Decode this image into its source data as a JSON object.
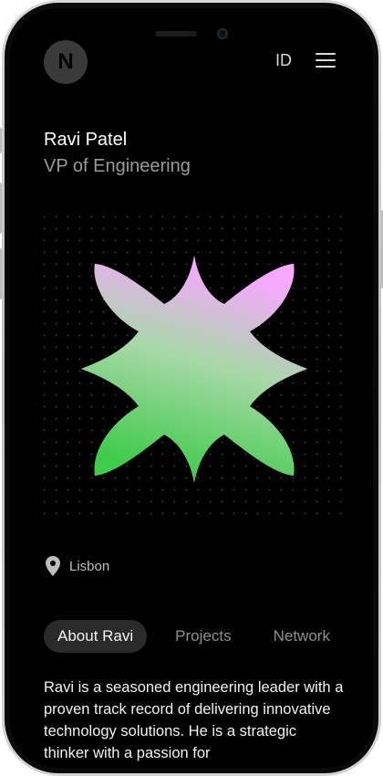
{
  "header": {
    "logo_letter": "N",
    "language": "ID"
  },
  "profile": {
    "name": "Ravi Patel",
    "role": "VP of Engineering",
    "location": "Lisbon"
  },
  "tabs": [
    {
      "label": "About Ravi",
      "active": true
    },
    {
      "label": "Projects",
      "active": false
    },
    {
      "label": "Network",
      "active": false
    }
  ],
  "bio": "Ravi is a seasoned engineering leader with a proven track record of delivering innovative technology solutions. He is a strategic thinker with a passion for",
  "colors": {
    "background": "#000000",
    "gradient_top": "#f7a8ff",
    "gradient_bottom": "#3fcc4a",
    "active_tab_bg": "#2a2a2a"
  },
  "icons": [
    "menu-icon",
    "location-pin-icon"
  ]
}
